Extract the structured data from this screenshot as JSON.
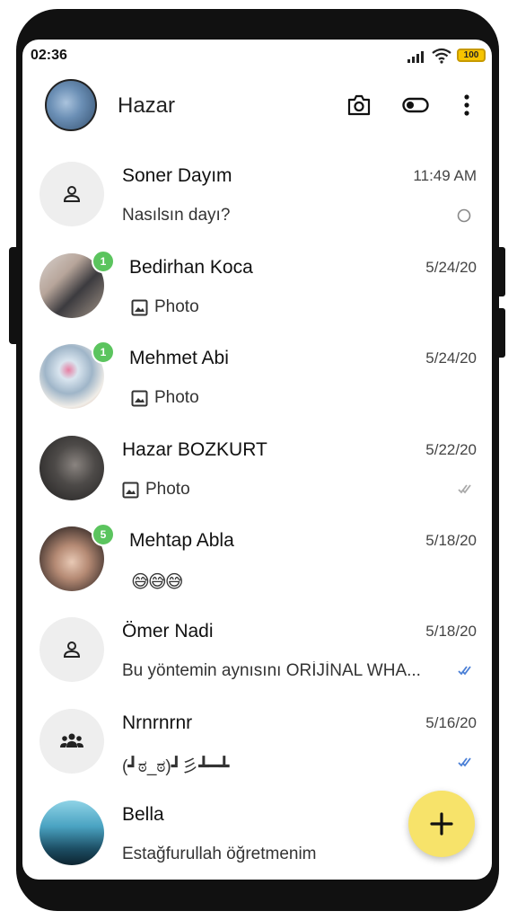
{
  "status": {
    "time": "02:36",
    "battery": "100"
  },
  "header": {
    "title": "Hazar"
  },
  "chats": [
    {
      "name": "Soner Dayım",
      "date": "11:49 AM",
      "preview": "Nasılsın dayı?",
      "avatar_icon": "person-icon"
    },
    {
      "name": "Bedirhan Koca",
      "date": "5/24/20",
      "preview": "Photo",
      "badge": "1"
    },
    {
      "name": "Mehmet Abi",
      "date": "5/24/20",
      "preview": "Photo",
      "badge": "1"
    },
    {
      "name": "Hazar BOZKURT",
      "date": "5/22/20",
      "preview": "Photo"
    },
    {
      "name": "Mehtap Abla",
      "date": "5/18/20",
      "preview": "😅😅😅",
      "badge": "5"
    },
    {
      "name": "Ömer Nadi",
      "date": "5/18/20",
      "preview": "Bu yöntemin aynısını ORİJİNAL WHA...",
      "avatar_icon": "person-icon"
    },
    {
      "name": "Nrnrnrnr",
      "date": "5/16/20",
      "preview": "(┛ಠ_ಠ)┛彡┻━┻",
      "avatar_icon": "group-icon"
    },
    {
      "name": "Bella",
      "date": "",
      "preview": "Estağfurullah öğretmenim"
    }
  ],
  "colors": {
    "accent": "#f7e36a",
    "badge": "#5bc45e",
    "tick_read": "#4a7fd6"
  }
}
